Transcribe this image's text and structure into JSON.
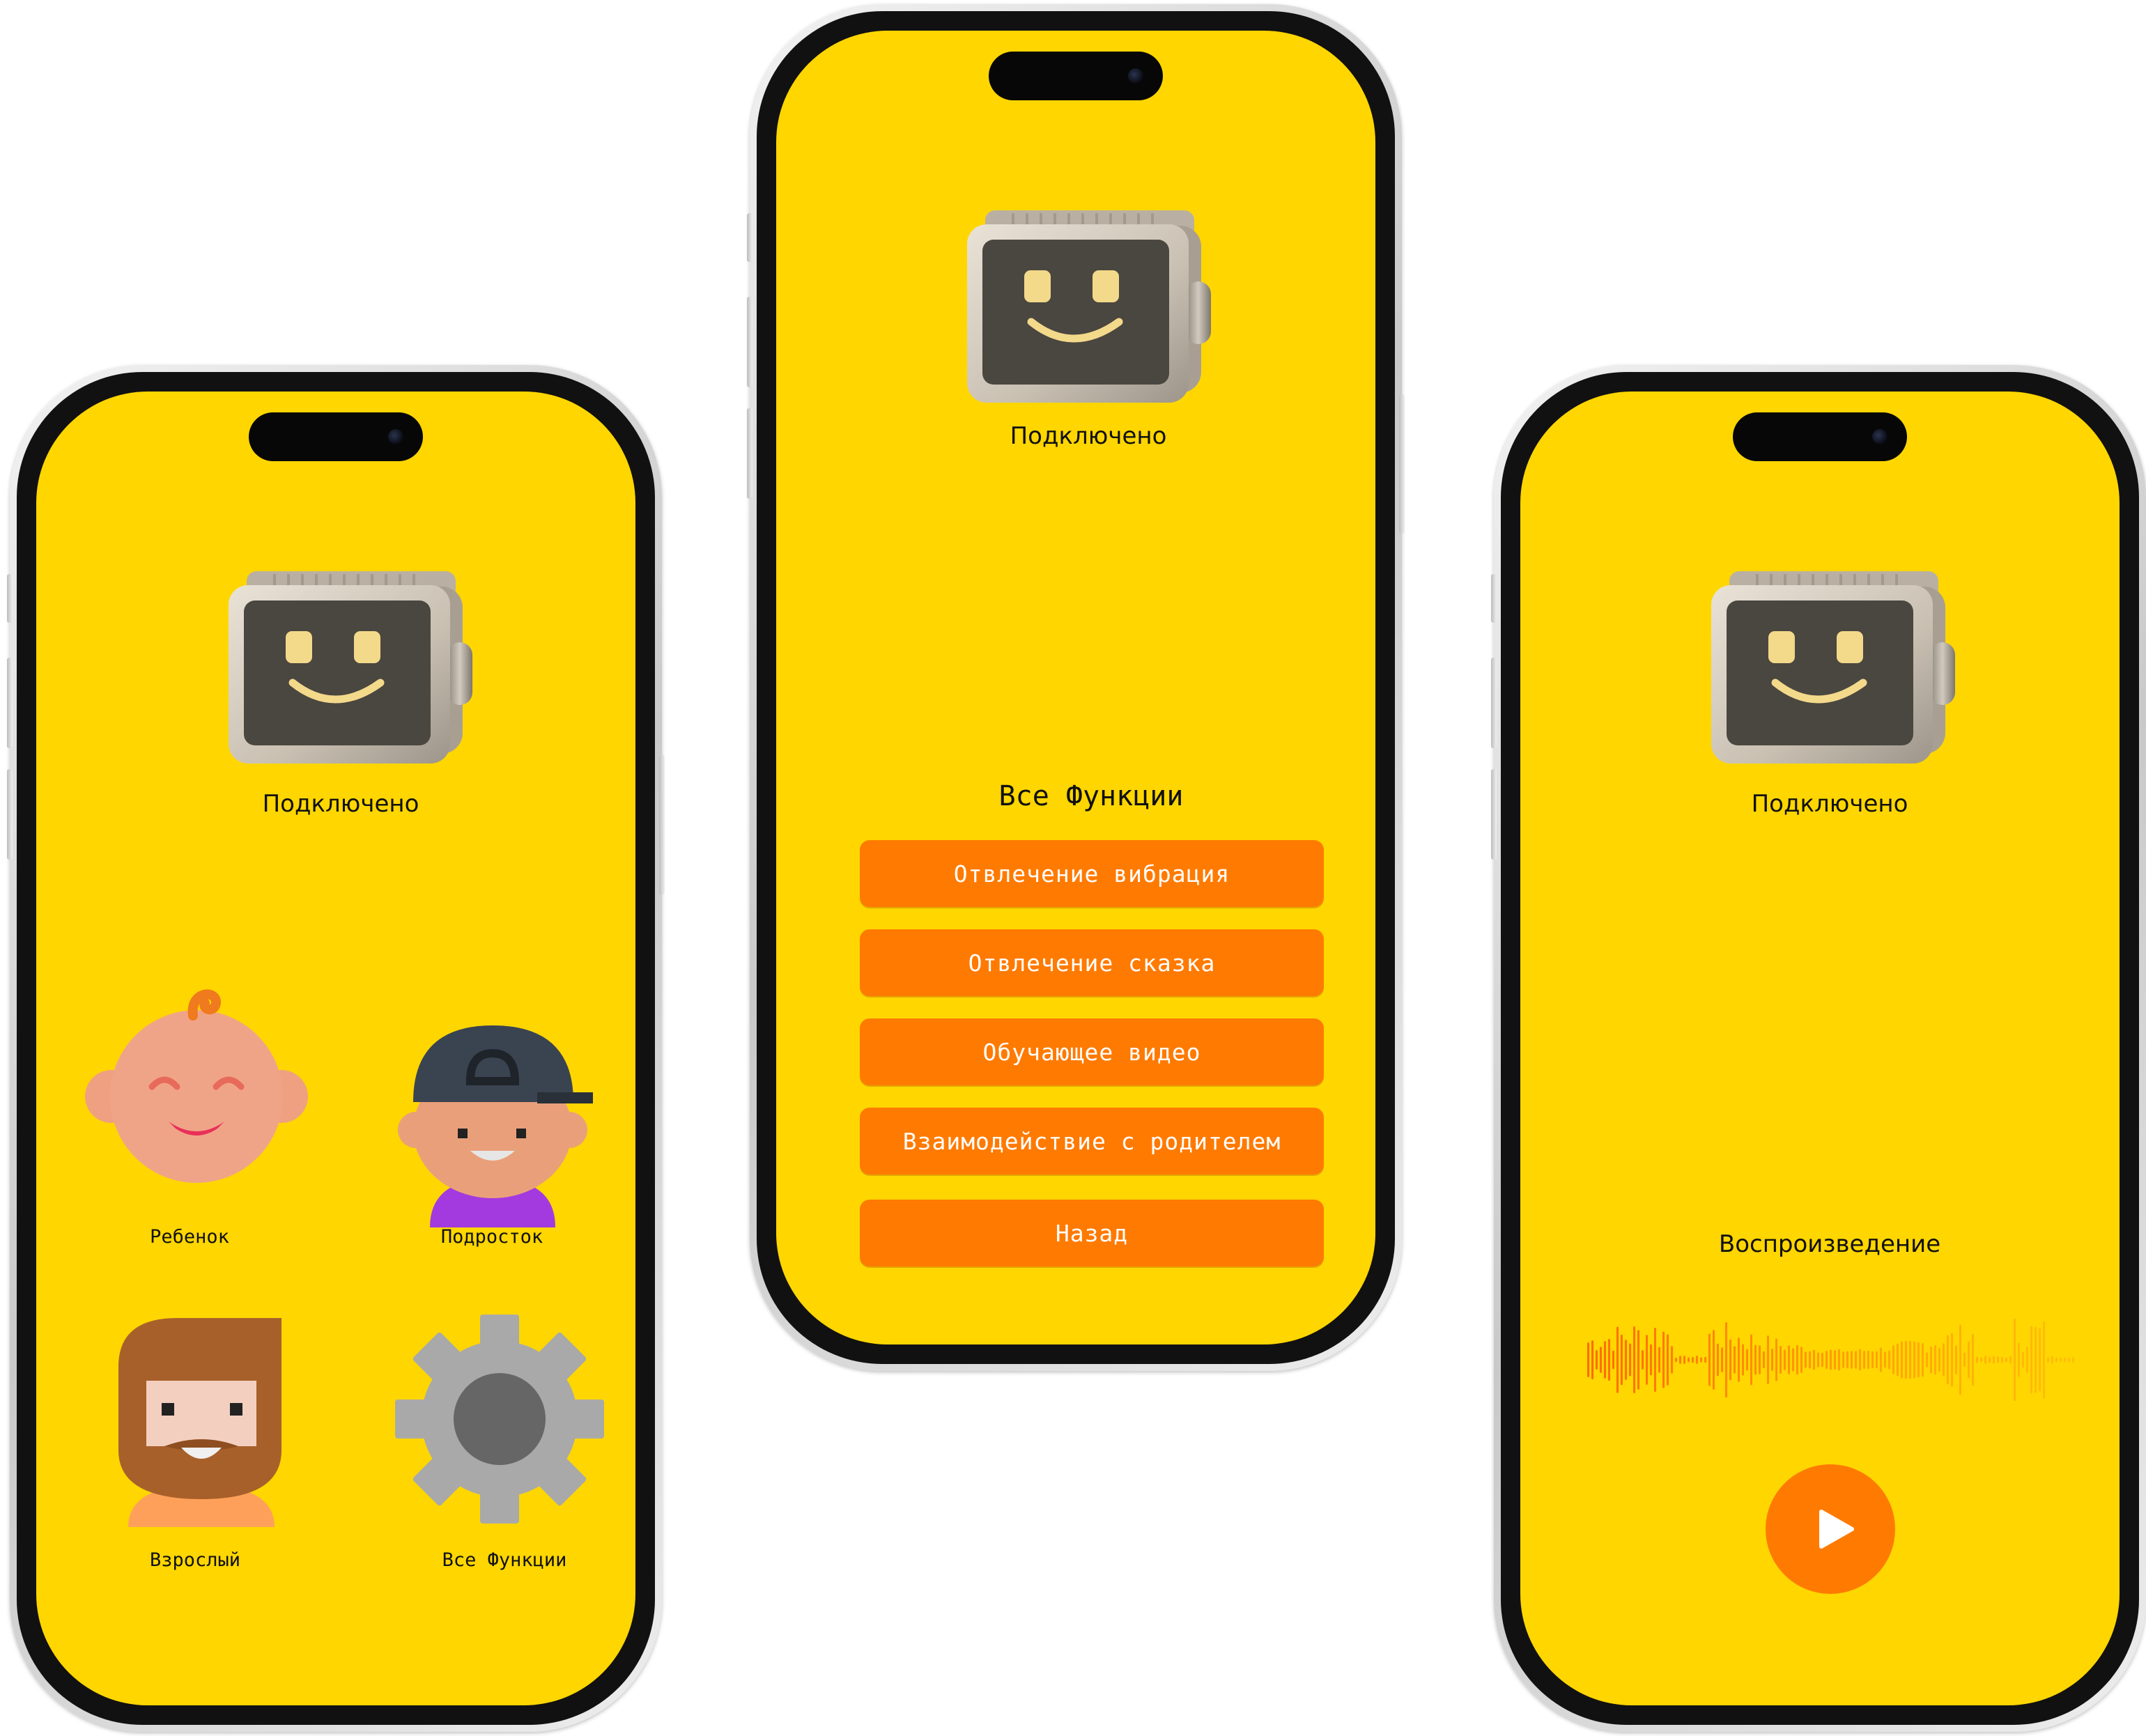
{
  "colors": {
    "screen_bg": "#FFD600",
    "accent_orange": "#FF7A00",
    "robot_screen": "#4a4640",
    "robot_face": "#F3D98A"
  },
  "phone_left": {
    "status": "Подключено",
    "profiles": [
      {
        "icon": "baby-face-icon",
        "label": "Ребенок"
      },
      {
        "icon": "teen-face-icon",
        "label": "Подросток"
      },
      {
        "icon": "bearded-man-icon",
        "label": "Взрослый"
      },
      {
        "icon": "gear-icon",
        "label": "Все Функции"
      }
    ]
  },
  "phone_center": {
    "status": "Подключено",
    "functions_title": "Все Функции",
    "buttons": [
      "Отвлечение вибрация",
      "Отвлечение сказка",
      "Обучающее видео",
      "Взаимодействие с родителем",
      "Назад"
    ]
  },
  "phone_right": {
    "status": "Подключено",
    "playback_label": "Воспроизведение",
    "waveform_icon": "audio-waveform-icon",
    "play_icon": "play-icon"
  }
}
